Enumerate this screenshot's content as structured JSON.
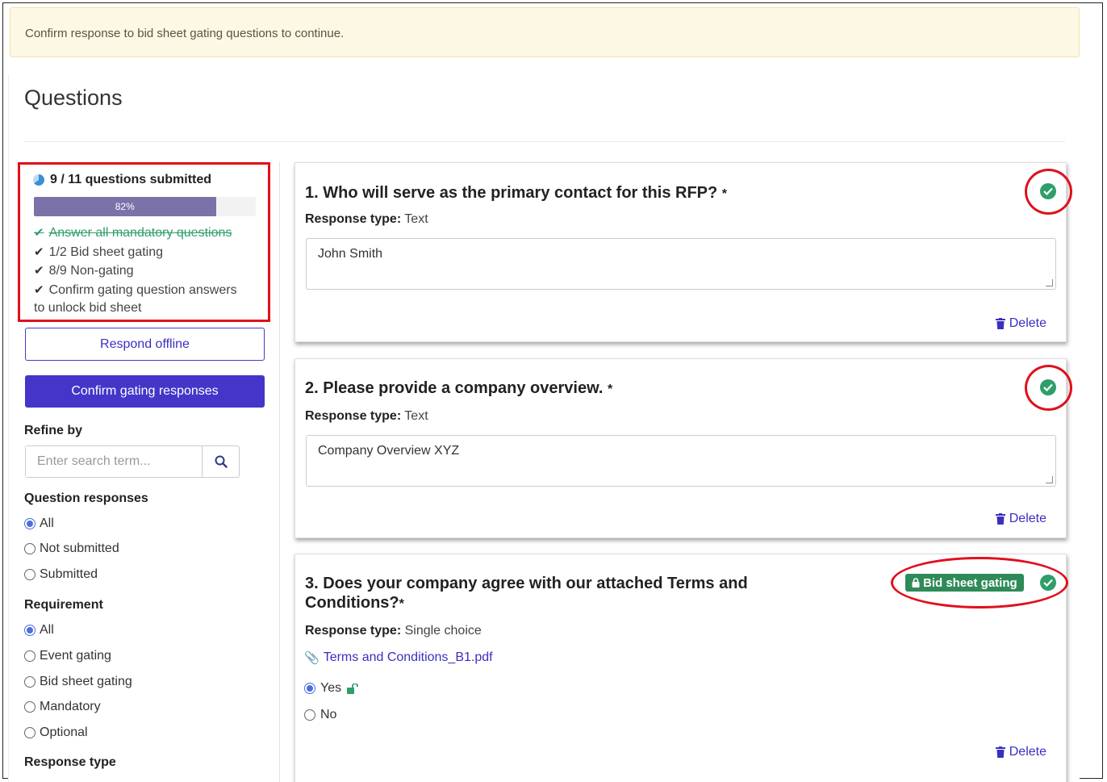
{
  "alert": {
    "text": "Confirm response to bid sheet gating questions to continue."
  },
  "page": {
    "title": "Questions"
  },
  "sidebar": {
    "progress": {
      "heading": "9 / 11 questions submitted",
      "percent_label": "82%",
      "percent": 82,
      "items": [
        {
          "label": "Answer all mandatory questions",
          "completed": true
        },
        {
          "label": "1/2 Bid sheet gating",
          "completed": false
        },
        {
          "label": "8/9 Non-gating",
          "completed": false
        },
        {
          "label": "Confirm gating question answers",
          "completed": false
        }
      ],
      "wrap_text": "to unlock bid sheet"
    },
    "respond_offline_label": "Respond offline",
    "confirm_label": "Confirm gating responses",
    "refine_heading": "Refine by",
    "search_placeholder": "Enter search term...",
    "question_responses": {
      "heading": "Question responses",
      "options": [
        "All",
        "Not submitted",
        "Submitted"
      ],
      "selected": "All"
    },
    "requirement": {
      "heading": "Requirement",
      "options": [
        "All",
        "Event gating",
        "Bid sheet gating",
        "Mandatory",
        "Optional"
      ],
      "selected": "All"
    },
    "response_type_heading": "Response type"
  },
  "questions": [
    {
      "title": "1. Who will serve as the primary contact for this RFP?",
      "required_mark": "*",
      "type_label": "Response type:",
      "type_value": "Text",
      "answer": "John Smith",
      "delete_label": "Delete",
      "submitted": true
    },
    {
      "title": "2. Please provide a company overview.",
      "required_mark": "*",
      "type_label": "Response type:",
      "type_value": "Text",
      "answer": "Company Overview XYZ",
      "delete_label": "Delete",
      "submitted": true
    },
    {
      "title_line1": "3. Does your company agree with our attached Terms and",
      "title_line2": "Conditions?",
      "required_mark": "*",
      "type_label": "Response type:",
      "type_value": "Single choice",
      "badge": "Bid sheet gating",
      "attachment": "Terms and Conditions_B1.pdf",
      "options": [
        "Yes",
        "No"
      ],
      "selected": "Yes",
      "delete_label": "Delete",
      "submitted": true
    }
  ],
  "colors": {
    "accent": "#4535c9",
    "success": "#2f9e6b",
    "highlight": "#e0101d",
    "progress": "#7a72a8"
  }
}
